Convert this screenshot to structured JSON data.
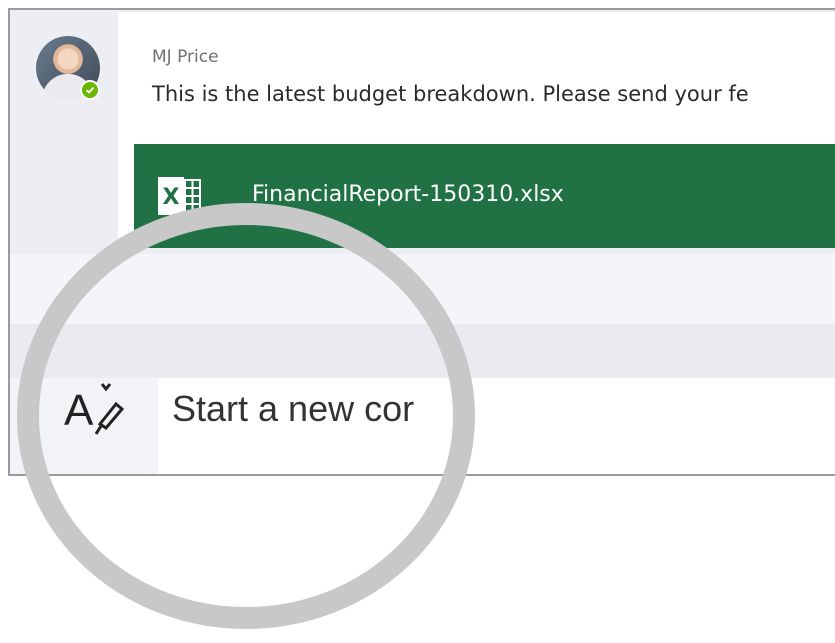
{
  "message": {
    "sender": "MJ Price",
    "text": "This is the latest budget breakdown. Please send your fe",
    "avatar_icon": "user-avatar",
    "presence_icon": "available-check-icon",
    "presence_color": "#6bb700"
  },
  "attachment": {
    "file_name": "FinancialReport-150310.xlsx",
    "icon": "excel-icon",
    "color": "#207245"
  },
  "composer": {
    "format_icon": "format-text-icon",
    "new_conversation_label": "Start a new cor"
  },
  "overlay": {
    "icon": "magnifier-lens"
  }
}
